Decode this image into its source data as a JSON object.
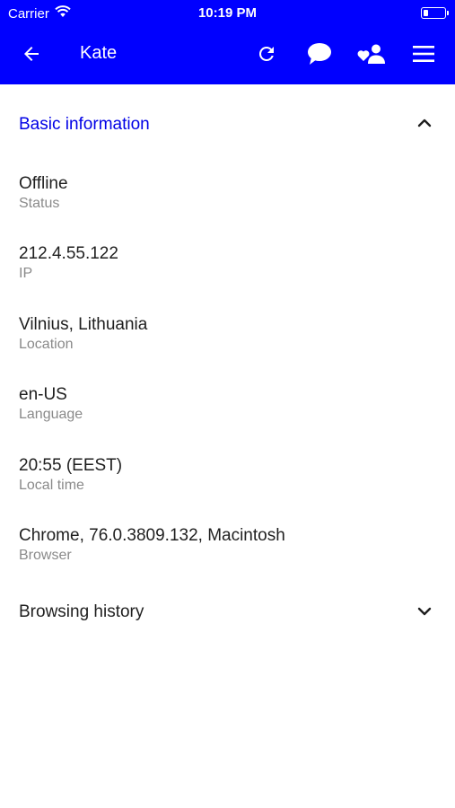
{
  "status_bar": {
    "carrier": "Carrier",
    "time": "10:19 PM"
  },
  "app_bar": {
    "title": "Kate"
  },
  "basic_info": {
    "title": "Basic information",
    "rows": [
      {
        "value": "Offline",
        "label": "Status"
      },
      {
        "value": "212.4.55.122",
        "label": "IP"
      },
      {
        "value": "Vilnius, Lithuania",
        "label": "Location"
      },
      {
        "value": "en-US",
        "label": "Language"
      },
      {
        "value": "20:55 (EEST)",
        "label": "Local time"
      },
      {
        "value": "Chrome, 76.0.3809.132, Macintosh",
        "label": "Browser"
      }
    ]
  },
  "browsing_history": {
    "title": "Browsing history"
  },
  "colors": {
    "accent": "#0000ff",
    "header_text": "#0000e6",
    "secondary_text": "#8a8a8a"
  }
}
